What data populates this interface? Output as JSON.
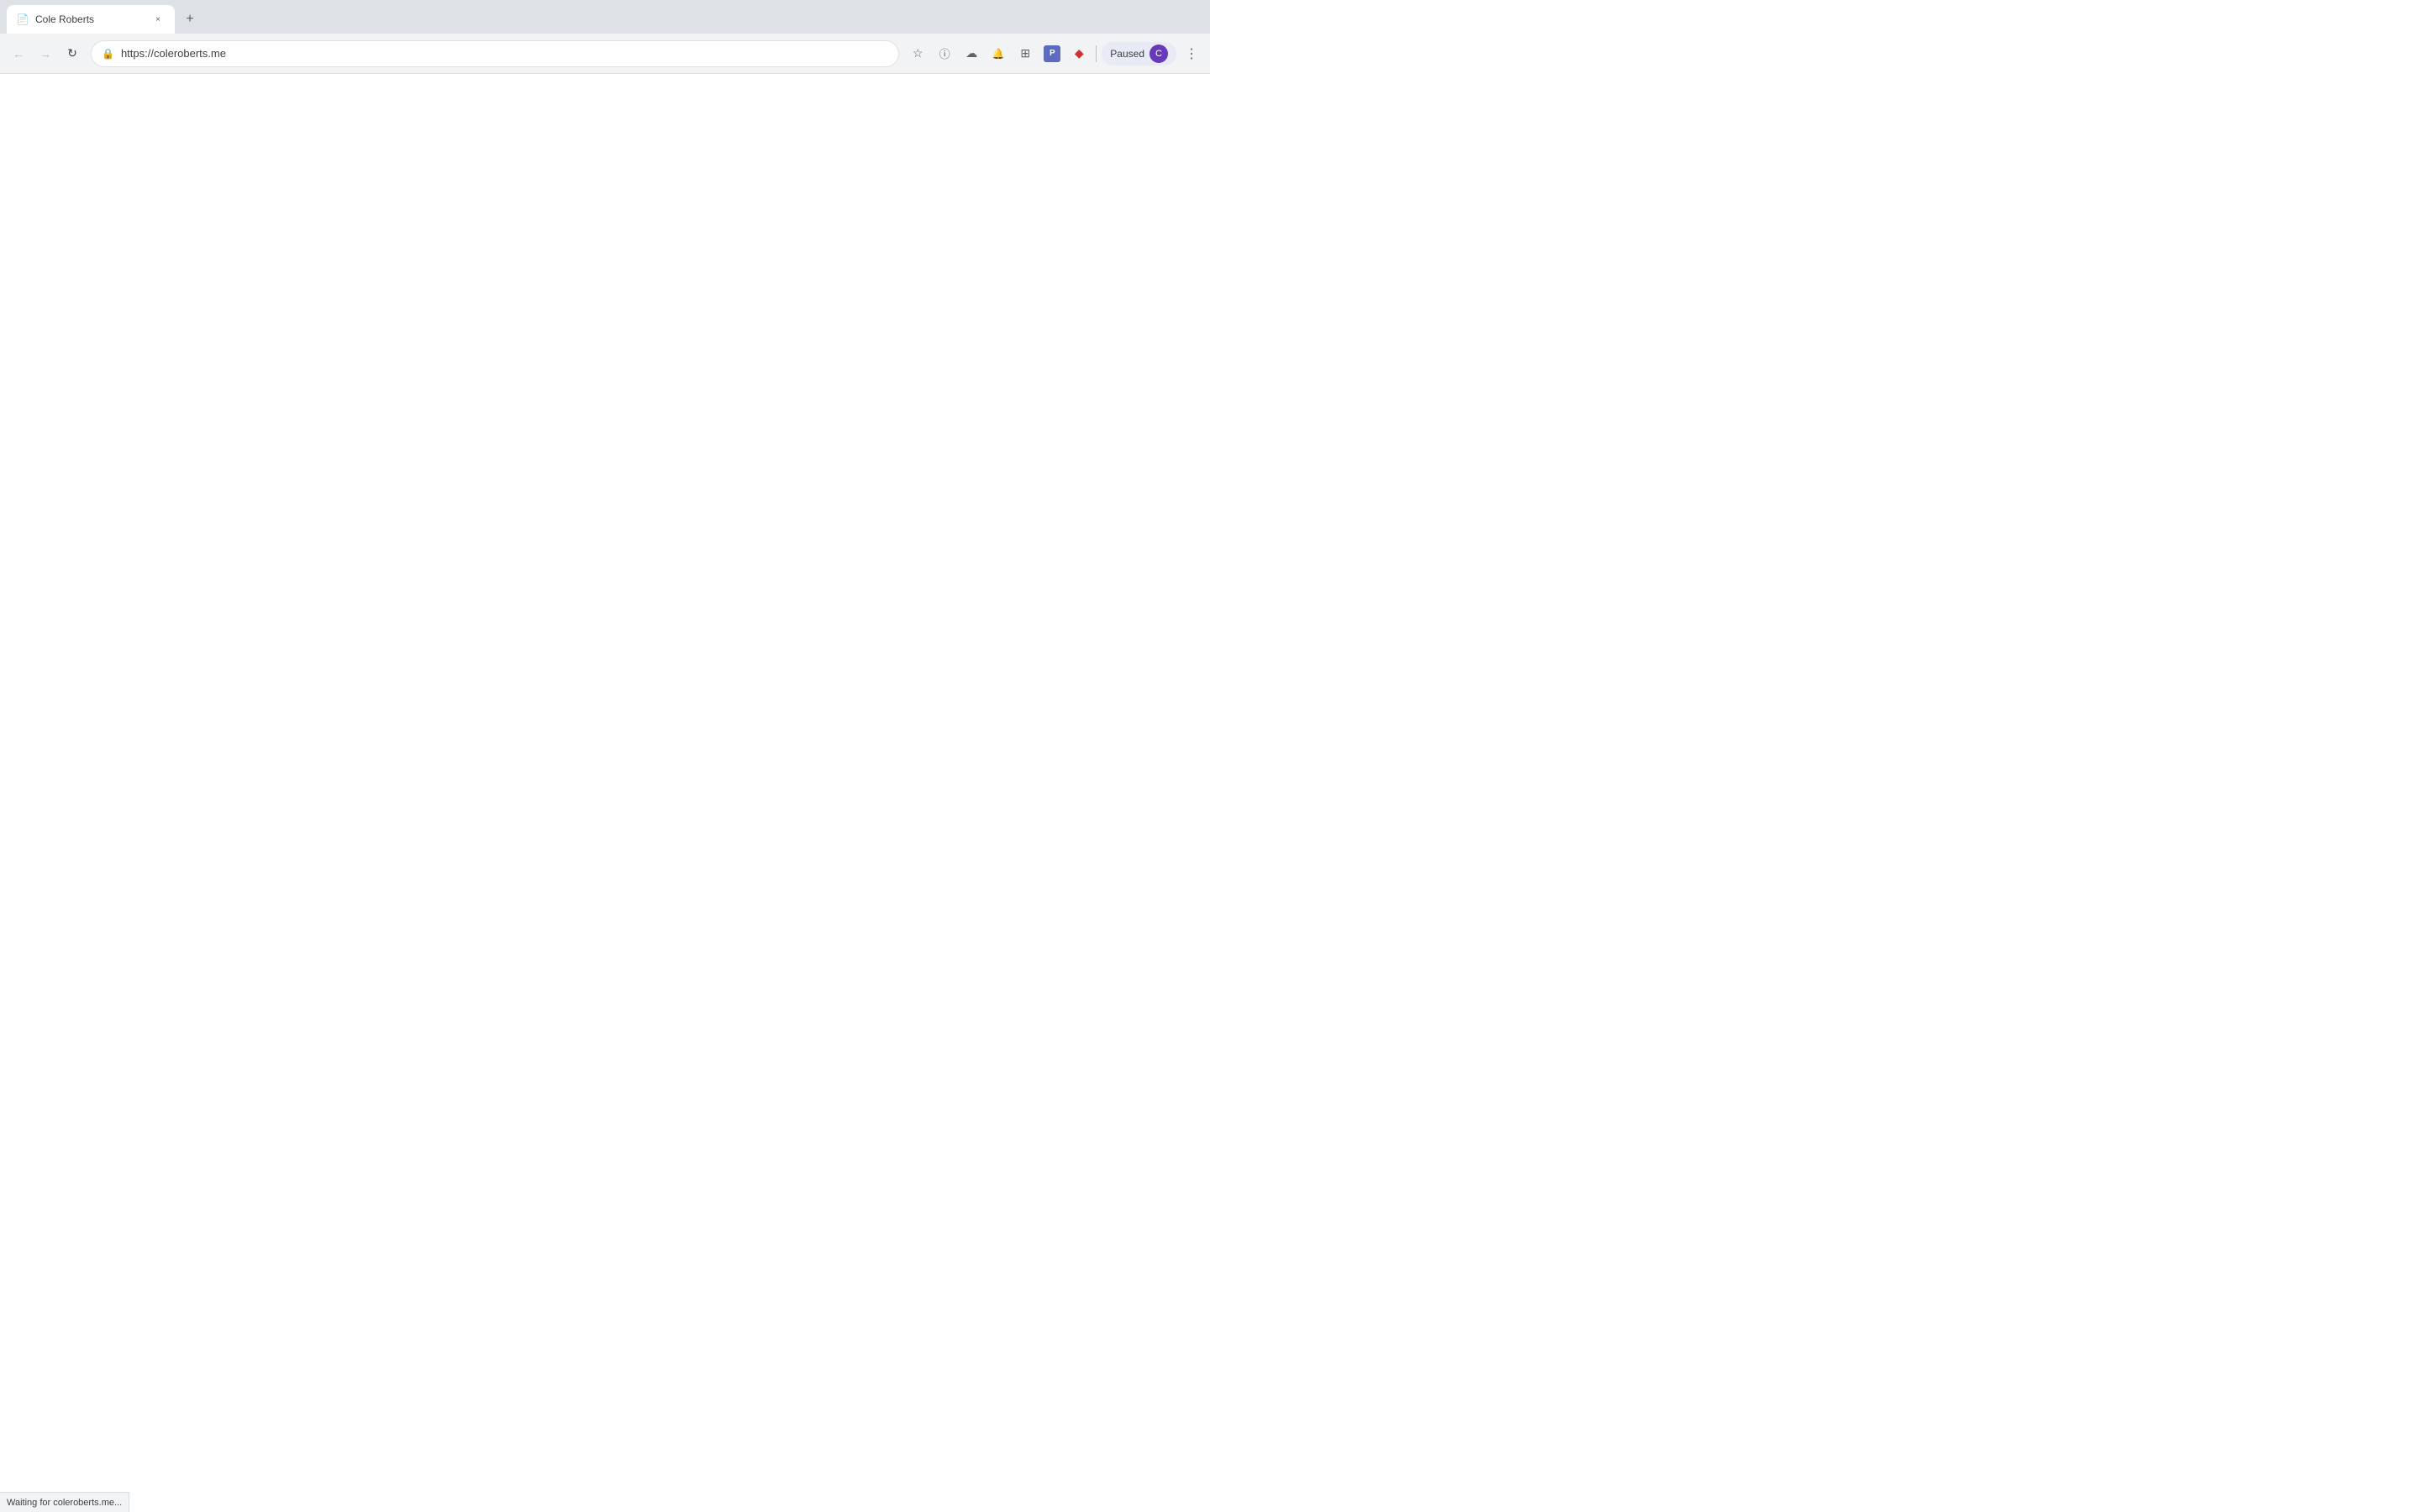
{
  "browser": {
    "tab": {
      "favicon": "📄",
      "title": "Cole Roberts",
      "close_label": "×"
    },
    "new_tab_label": "+",
    "nav": {
      "back_label": "←",
      "forward_label": "→",
      "reload_label": "↻",
      "url": "https://coleroberts.me",
      "lock_icon": "🔒"
    },
    "toolbar_icons": {
      "bookmark_label": "☆",
      "info_label": "ⓘ",
      "cloud_label": "☁",
      "bell_label": "🔔",
      "puzzle_label": "⊞",
      "p_label": "P",
      "diamond_label": "◆",
      "paused_label": "Paused",
      "avatar_label": "C",
      "more_label": "⋮"
    },
    "status_bar": {
      "text": "Waiting for coleroberts.me..."
    }
  }
}
